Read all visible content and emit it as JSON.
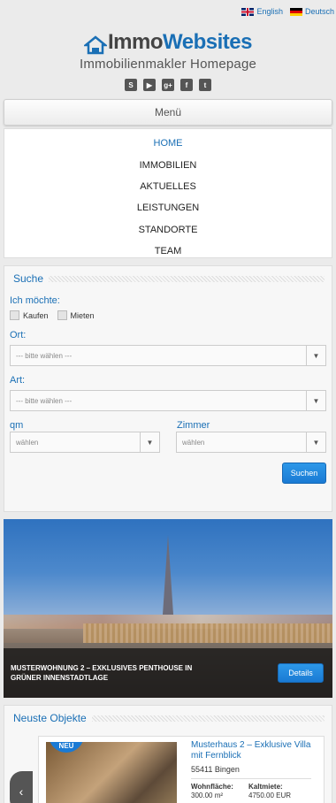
{
  "languages": [
    {
      "label": "English",
      "flag": "uk-flag"
    },
    {
      "label": "Deutsch",
      "flag": "de-flag"
    }
  ],
  "brand": {
    "part1": "Immo",
    "part2": "Websites",
    "tagline": "Immobilienmakler Homepage",
    "colors": {
      "primary": "#1a6fb5",
      "dark": "#444444"
    }
  },
  "socials": [
    {
      "icon": "skype-icon",
      "glyph": "S"
    },
    {
      "icon": "youtube-icon",
      "glyph": "▶"
    },
    {
      "icon": "google-plus-icon",
      "glyph": "g+"
    },
    {
      "icon": "facebook-icon",
      "glyph": "f"
    },
    {
      "icon": "twitter-icon",
      "glyph": "t"
    }
  ],
  "menu": {
    "toggle_label": "Menü",
    "items": [
      {
        "label": "HOME",
        "active": true
      },
      {
        "label": "IMMOBILIEN"
      },
      {
        "label": "AKTUELLES"
      },
      {
        "label": "LEISTUNGEN"
      },
      {
        "label": "STANDORTE"
      },
      {
        "label": "TEAM"
      }
    ]
  },
  "search": {
    "title": "Suche",
    "intent_label": "Ich möchte:",
    "buy_label": "Kaufen",
    "rent_label": "Mieten",
    "location_label": "Ort:",
    "location_value": "--- bitte wählen ---",
    "type_label": "Art:",
    "type_value": "--- bitte wählen ---",
    "area_label": "qm",
    "area_value": "wählen",
    "rooms_label": "Zimmer",
    "rooms_value": "wählen",
    "submit_label": "Suchen"
  },
  "slider": {
    "caption": "MUSTERWOHNUNG 2 – EXKLUSIVES PENTHOUSE IN GRÜNER INNENSTADTLAGE",
    "details_label": "Details"
  },
  "objects": {
    "title": "Neuste Objekte",
    "badge": "NEU",
    "item": {
      "title": "Musterhaus 2 – Exklusive Villa mit Fernblick",
      "location": "55411 Bingen",
      "area_label": "Wohnfläche:",
      "area_value": "300.00 m²",
      "rent_label": "Kaltmiete:",
      "rent_value": "4750.00 EUR"
    }
  }
}
